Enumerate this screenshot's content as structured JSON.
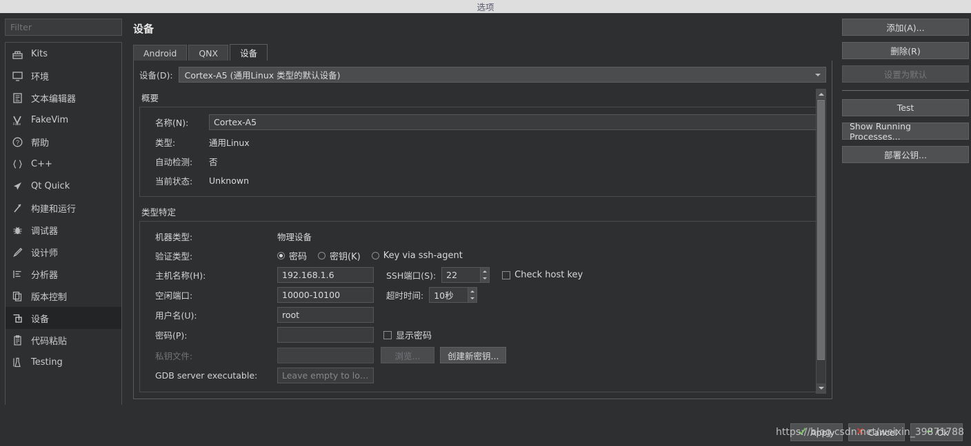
{
  "window": {
    "title": "选项"
  },
  "sidebar": {
    "filter_placeholder": "Filter",
    "items": [
      {
        "label": "Kits",
        "icon": "kits-icon"
      },
      {
        "label": "环境",
        "icon": "monitor-icon"
      },
      {
        "label": "文本编辑器",
        "icon": "text-editor-icon"
      },
      {
        "label": "FakeVim",
        "icon": "fakevim-icon"
      },
      {
        "label": "帮助",
        "icon": "help-icon"
      },
      {
        "label": "C++",
        "icon": "braces-icon"
      },
      {
        "label": "Qt Quick",
        "icon": "paper-plane-icon"
      },
      {
        "label": "构建和运行",
        "icon": "hammer-icon"
      },
      {
        "label": "调试器",
        "icon": "bug-icon"
      },
      {
        "label": "设计师",
        "icon": "pencil-icon"
      },
      {
        "label": "分析器",
        "icon": "analyzer-icon"
      },
      {
        "label": "版本控制",
        "icon": "version-control-icon"
      },
      {
        "label": "设备",
        "icon": "device-icon",
        "selected": true
      },
      {
        "label": "代码粘贴",
        "icon": "clipboard-icon"
      },
      {
        "label": "Testing",
        "icon": "flask-icon"
      }
    ]
  },
  "main": {
    "page_title": "设备",
    "tabs": [
      {
        "label": "Android",
        "active": false
      },
      {
        "label": "QNX",
        "active": false
      },
      {
        "label": "设备",
        "active": true
      }
    ],
    "device_selector": {
      "label": "设备(D):",
      "value": "Cortex-A5 (通用Linux 类型的默认设备)"
    },
    "summary": {
      "title": "概要",
      "name_label": "名称(N):",
      "name_value": "Cortex-A5",
      "type_label": "类型:",
      "type_value": "通用Linux",
      "autodetect_label": "自动检测:",
      "autodetect_value": "否",
      "state_label": "当前状态:",
      "state_value": "Unknown"
    },
    "type_specific": {
      "title": "类型特定",
      "machine_type_label": "机器类型:",
      "machine_type_value": "物理设备",
      "auth_type_label": "验证类型:",
      "auth_options": [
        {
          "label": "密码",
          "selected": true
        },
        {
          "label": "密钥(K)",
          "selected": false
        },
        {
          "label": "Key via ssh-agent",
          "selected": false
        }
      ],
      "host_label": "主机名称(H):",
      "host_value": "192.168.1.6",
      "ssh_port_label": "SSH端口(S):",
      "ssh_port_value": "22",
      "check_host_key_label": "Check host key",
      "free_ports_label": "空闲端口:",
      "free_ports_value": "10000-10100",
      "timeout_label": "超时时间:",
      "timeout_value": "10秒",
      "username_label": "用户名(U):",
      "username_value": "root",
      "password_label": "密码(P):",
      "password_value": "",
      "show_password_label": "显示密码",
      "private_key_label": "私钥文件:",
      "private_key_value": "",
      "browse_label": "浏览...",
      "create_key_label": "创建新密钥...",
      "gdb_label": "GDB server executable:",
      "gdb_placeholder": "Leave empty to lo…"
    }
  },
  "actions": {
    "add": "添加(A)...",
    "remove": "删除(R)",
    "set_default": "设置为默认",
    "test": "Test",
    "show_running": "Show Running Processes...",
    "deploy_key": "部署公钥..."
  },
  "footer": {
    "apply": "Apply",
    "cancel": "Cancel",
    "ok": "Ok",
    "watermark": "https://blog.csdn.net/weixin_39871788"
  },
  "colors": {
    "bg": "#2e2f30",
    "panel_border": "#5a5b5d",
    "selected_nav": "#232426",
    "titlebar": "#dedede"
  }
}
